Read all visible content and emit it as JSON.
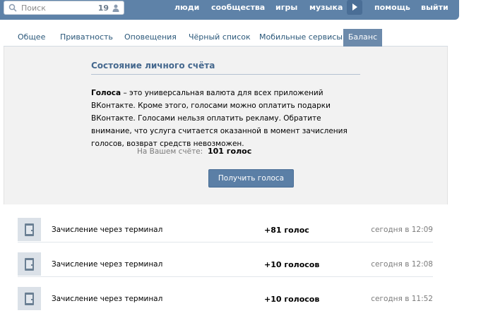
{
  "topbar": {
    "search_placeholder": "Поиск",
    "search_count": "19",
    "nav": [
      "люди",
      "сообщества",
      "игры",
      "музыка",
      "помощь",
      "выйти"
    ]
  },
  "tabs": [
    "Общее",
    "Приватность",
    "Оповещения",
    "Чёрный список",
    "Мобильные сервисы",
    "Баланс"
  ],
  "active_tab": "Баланс",
  "panel": {
    "title": "Состояние личного счёта",
    "desc_bold": "Голоса",
    "desc_rest": " – это универсальная валюта для всех приложений ВКонтакте. Кроме этого, голосами можно оплатить подарки ВКонтакте. Голосами нельзя оплатить рекламу. Обратите внимание, что услуга считается оказанной в момент зачисления голосов, возврат средств невозможен.",
    "balance_label": "На Вашем счёте:",
    "balance_value": "101 голос",
    "button_label": "Получить голоса"
  },
  "transactions": [
    {
      "description": "Зачисление через терминал",
      "amount": "+81 голос",
      "time": "сегодня в 12:09"
    },
    {
      "description": "Зачисление через терминал",
      "amount": "+10 голосов",
      "time": "сегодня в 12:08"
    },
    {
      "description": "Зачисление через терминал",
      "amount": "+10 голосов",
      "time": "сегодня в 11:52"
    }
  ],
  "colors": {
    "topbar": "#5e82a8",
    "accent": "#45688e",
    "active_tab": "#6c8aab",
    "button": "#5b7fa6"
  }
}
